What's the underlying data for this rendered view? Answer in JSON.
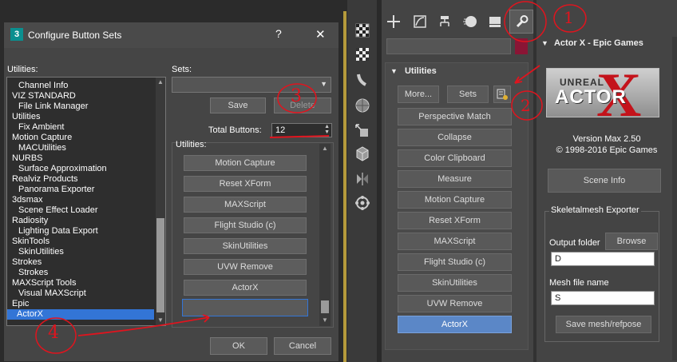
{
  "dialog": {
    "title": "Configure Button Sets",
    "help": "?",
    "close": "✕",
    "utilities_label": "Utilities:",
    "sets_label": "Sets:",
    "save": "Save",
    "delete": "Delete",
    "total_buttons_label": "Total Buttons:",
    "total_buttons_value": "12",
    "utilities_set_label": "Utilities:",
    "ok": "OK",
    "cancel": "Cancel",
    "list": [
      {
        "text": "Channel Info",
        "indent": true
      },
      {
        "text": "VIZ STANDARD",
        "indent": false
      },
      {
        "text": "File Link Manager",
        "indent": true
      },
      {
        "text": "Utilities",
        "indent": false
      },
      {
        "text": "Fix Ambient",
        "indent": true
      },
      {
        "text": "Motion Capture",
        "indent": false
      },
      {
        "text": "MACUtilities",
        "indent": true
      },
      {
        "text": "NURBS",
        "indent": false
      },
      {
        "text": "Surface Approximation",
        "indent": true
      },
      {
        "text": "Realviz Products",
        "indent": false
      },
      {
        "text": "Panorama Exporter",
        "indent": true
      },
      {
        "text": "3dsmax",
        "indent": false
      },
      {
        "text": "Scene Effect Loader",
        "indent": true
      },
      {
        "text": "Radiosity",
        "indent": false
      },
      {
        "text": "Lighting Data Export",
        "indent": true
      },
      {
        "text": "SkinTools",
        "indent": false
      },
      {
        "text": "SkinUtilities",
        "indent": true
      },
      {
        "text": "Strokes",
        "indent": false
      },
      {
        "text": "Strokes",
        "indent": true
      },
      {
        "text": "MAXScript Tools",
        "indent": false
      },
      {
        "text": "Visual MAXScript",
        "indent": true
      },
      {
        "text": "Epic",
        "indent": false
      },
      {
        "text": "ActorX",
        "indent": true,
        "selected": true
      }
    ],
    "set_buttons": [
      "Motion Capture",
      "Reset XForm",
      "MAXScript",
      "Flight Studio (c)",
      "SkinUtilities",
      "UVW Remove",
      "ActorX",
      ""
    ]
  },
  "command_panel": {
    "rollout_title": "Utilities",
    "more": "More...",
    "sets": "Sets",
    "buttons": [
      "Perspective Match",
      "Collapse",
      "Color Clipboard",
      "Measure",
      "Motion Capture",
      "Reset XForm",
      "MAXScript",
      "Flight Studio (c)",
      "SkinUtilities",
      "UVW Remove",
      "ActorX"
    ]
  },
  "actorx": {
    "title": "Actor X - Epic Games",
    "logo_top": "UNREAL",
    "logo_main": "ACTOR",
    "logo_x": "X",
    "version": "Version Max 2.50",
    "copyright": "© 1998-2016  Epic Games",
    "scene_info": "Scene Info",
    "group_title": "Skeletalmesh Exporter",
    "output_folder_label": "Output folder",
    "browse": "Browse",
    "output_folder_value": "D",
    "mesh_file_label": "Mesh file name",
    "mesh_file_value": "S",
    "save_mesh": "Save mesh/refpose"
  },
  "annotations": [
    "1",
    "2",
    "3",
    "4"
  ],
  "colors": {
    "accent": "#5b87c7",
    "selection": "#3375d6",
    "annotation": "#e0141e",
    "dialog_bg": "#454545"
  }
}
